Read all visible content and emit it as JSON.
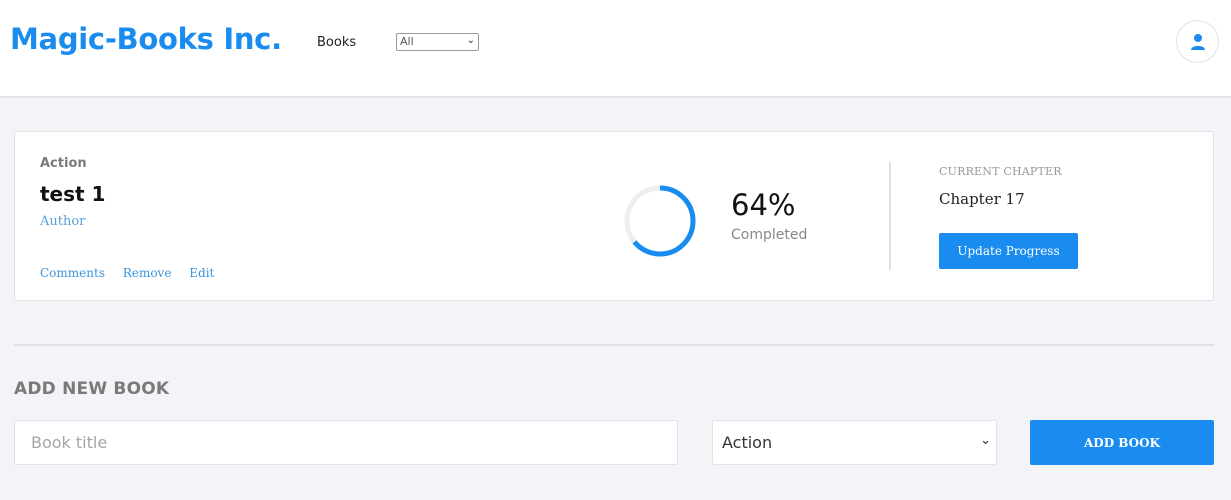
{
  "header": {
    "brand": "Magic-Books Inc.",
    "nav_books": "Books",
    "genre_filter": {
      "selected": "All"
    }
  },
  "book": {
    "genre": "Action",
    "title": "test 1",
    "author": "Author",
    "actions": {
      "comments": "Comments",
      "remove": "Remove",
      "edit": "Edit"
    },
    "progress_fraction": 0.64,
    "progress_text": "64%",
    "completed_label": "Completed",
    "chapter_caption": "CURRENT CHAPTER",
    "chapter_value": "Chapter 17",
    "update_button": "Update Progress"
  },
  "add_book": {
    "section_title": "ADD NEW BOOK",
    "title_placeholder": "Book title",
    "genre_selected": "Action",
    "add_button": "ADD BOOK"
  },
  "colors": {
    "accent": "#1a8cf0",
    "background": "#f3f4f8",
    "progress_track": "#eeeeee"
  },
  "icons": {
    "avatar": "user-icon",
    "dropdown": "chevron-down-icon"
  }
}
